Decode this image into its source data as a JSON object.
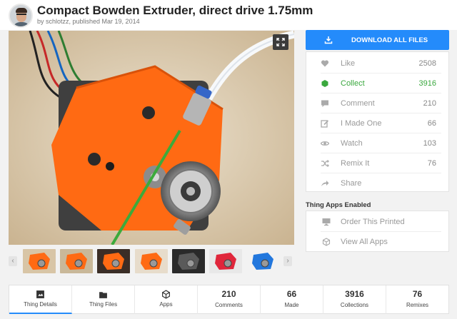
{
  "header": {
    "title": "Compact Bowden Extruder, direct drive 1.75mm",
    "subtitle": "by schlotzz, published Mar 19, 2014",
    "avatar_icon": "user-avatar"
  },
  "gallery": {
    "expand_icon": "expand-icon",
    "prev_label": "‹",
    "next_label": "›",
    "thumbnails": [
      {
        "color": "#ff6a13",
        "bg": "#d8c5a6"
      },
      {
        "color": "#ff6a13",
        "bg": "#c9b899"
      },
      {
        "color": "#ff6a13",
        "bg": "#3a2d26"
      },
      {
        "color": "#ff6a13",
        "bg": "#e7dccb"
      },
      {
        "color": "#5a5a5a",
        "bg": "#2a2a2a"
      },
      {
        "color": "#e0263b",
        "bg": "#e8e8e8"
      },
      {
        "color": "#2277dd",
        "bg": "#f2f2f2"
      }
    ]
  },
  "sidebar": {
    "download_label": "DOWNLOAD ALL FILES",
    "stats": [
      {
        "key": "like",
        "label": "Like",
        "count": "2508",
        "icon": "heart-icon"
      },
      {
        "key": "collect",
        "label": "Collect",
        "count": "3916",
        "icon": "collect-icon"
      },
      {
        "key": "comment",
        "label": "Comment",
        "count": "210",
        "icon": "comment-icon"
      },
      {
        "key": "made",
        "label": "I Made One",
        "count": "66",
        "icon": "edit-icon"
      },
      {
        "key": "watch",
        "label": "Watch",
        "count": "103",
        "icon": "eye-icon"
      },
      {
        "key": "remix",
        "label": "Remix It",
        "count": "76",
        "icon": "shuffle-icon"
      },
      {
        "key": "share",
        "label": "Share",
        "count": "",
        "icon": "share-icon"
      }
    ],
    "apps_title": "Thing Apps Enabled",
    "apps": [
      {
        "label": "Order This Printed",
        "icon": "monitor-icon"
      },
      {
        "label": "View All Apps",
        "icon": "cube-icon"
      }
    ]
  },
  "tabs": [
    {
      "label": "Thing Details",
      "number": "",
      "icon": "details-icon",
      "active": true
    },
    {
      "label": "Thing Files",
      "number": "",
      "icon": "folder-icon",
      "active": false
    },
    {
      "label": "Apps",
      "number": "",
      "icon": "cube-icon",
      "active": false
    },
    {
      "label": "Comments",
      "number": "210",
      "icon": "",
      "active": false
    },
    {
      "label": "Made",
      "number": "66",
      "icon": "",
      "active": false
    },
    {
      "label": "Collections",
      "number": "3916",
      "icon": "",
      "active": false
    },
    {
      "label": "Remixes",
      "number": "76",
      "icon": "",
      "active": false
    }
  ],
  "colors": {
    "accent": "#248bfb",
    "collect_green": "#3aa83e",
    "part_orange": "#ff6a13"
  }
}
